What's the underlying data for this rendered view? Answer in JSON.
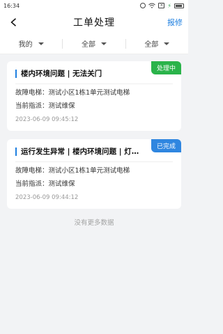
{
  "status_bar": {
    "time": "16:34",
    "icons": [
      "alarm-icon",
      "wifi-icon",
      "sim-x-icon",
      "bolt-icon",
      "battery-icon"
    ]
  },
  "header": {
    "title": "工单处理",
    "back_icon": "chevron-left-icon",
    "action_label": "报修",
    "accent": "#1e7fe0"
  },
  "filters": [
    {
      "label": "我的"
    },
    {
      "label": "全部"
    },
    {
      "label": "全部"
    }
  ],
  "orders": [
    {
      "title": "楼内环境问题 | 无法关门",
      "status": "处理中",
      "status_color": "#2ab34a",
      "fault_label": "故障电梯：",
      "fault_value": "测试小区1栋1单元测试电梯",
      "assignee_label": "当前指派：",
      "assignee_value": "测试维保",
      "time": "2023-06-09 09:45:12"
    },
    {
      "title": "运行发生异常 | 楼内环境问题 | 灯光照明故障",
      "status": "已完成",
      "status_color": "#2f86e0",
      "fault_label": "故障电梯：",
      "fault_value": "测试小区1栋1单元测试电梯",
      "assignee_label": "当前指派：",
      "assignee_value": "测试维保",
      "time": "2023-06-09 09:44:12"
    }
  ],
  "footer": {
    "no_more_text": "没有更多数据"
  }
}
